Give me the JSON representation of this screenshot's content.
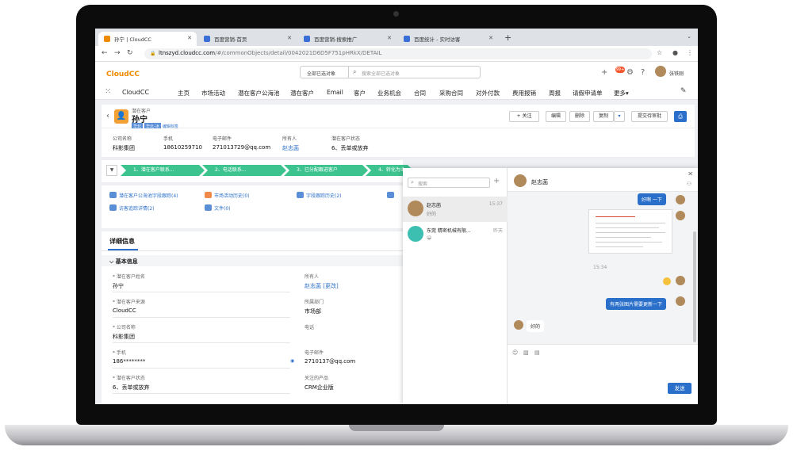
{
  "browser": {
    "tabs": [
      {
        "label": "孙宁 | CloudCC",
        "icon": "cloudcc-icon",
        "color": "#f08a00"
      },
      {
        "label": "百度营销-首页",
        "icon": "baidu-paw-icon",
        "color": "#3a6fd8"
      },
      {
        "label": "百度营销-搜索推广",
        "icon": "baidu-paw-icon",
        "color": "#3a6fd8"
      },
      {
        "label": "百度统计 - 实时访客",
        "icon": "baidu-stats-icon",
        "color": "#3a6fd8"
      }
    ],
    "url_host": "ltnszyd.cloudcc.com",
    "url_path": "/#/commonObjects/detail/0042021D6D5F751pHRkX/DETAIL"
  },
  "topbar": {
    "logo": "CloudCC",
    "search_scope": "全部已选对象",
    "search_placeholder": "搜索全部已选对象",
    "notification_count": "99+",
    "username": "张铁刚"
  },
  "nav": {
    "app_name": "CloudCC",
    "items": [
      "主页",
      "市场活动",
      "潜在客户公海池",
      "潜在客户",
      "Email",
      "客户",
      "业务机会",
      "合同",
      "采购合同",
      "对外付款",
      "费用报销",
      "周报",
      "请假申请单",
      "更多▾"
    ]
  },
  "record": {
    "type": "潜在客户",
    "name": "孙宁",
    "tags": [
      "华北",
      "华北-冰"
    ],
    "tag_edit": "编辑标签",
    "buttons": {
      "follow": "+ 关注",
      "edit": "编辑",
      "delete": "删除",
      "copy": "复制",
      "submit": "提交待审批"
    }
  },
  "summary_fields": [
    {
      "label": "公司名称",
      "value": "科影集团"
    },
    {
      "label": "手机",
      "value": "18610259710"
    },
    {
      "label": "电子邮件",
      "value": "271013729@qq.com"
    },
    {
      "label": "所有人",
      "value": "赵志菡"
    },
    {
      "label": "潜在客户状态",
      "value": "6、丢单或放弃"
    }
  ],
  "path_steps": [
    "1、潜在客户联系...",
    "2、电话联系...",
    "3、已分配跟进客户",
    "4、转化为业务..."
  ],
  "related": [
    {
      "label": "潜在客户公海池字段跟踪(4)",
      "color": "#5a8fd8"
    },
    {
      "label": "市场活动历史(0)",
      "color": "#f08a4b"
    },
    {
      "label": "字段跟踪历史(2)",
      "color": "#5a8fd8"
    },
    {
      "label": "访客追踪详情(2)",
      "color": "#5a8fd8"
    },
    {
      "label": "文件(0)",
      "color": "#5a8fd8"
    }
  ],
  "detail": {
    "tab": "详细信息",
    "section": "基本信息",
    "fields": [
      {
        "label": "* 潜在客户姓名",
        "value": "孙宁"
      },
      {
        "label": "所有人",
        "value": "赵志菡 [更改]"
      },
      {
        "label": "* 潜在客户来源",
        "value": "CloudCC"
      },
      {
        "label": "所属部门",
        "value": "市场部"
      },
      {
        "label": "* 公司名称",
        "value": "科影集团"
      },
      {
        "label": "电话",
        "value": ""
      },
      {
        "label": "* 手机",
        "value": "186********"
      },
      {
        "label": "电子邮件",
        "value": "2710137@qq.com"
      },
      {
        "label": "* 潜在客户状态",
        "value": "6、丢单或放弃"
      },
      {
        "label": "关注的产品",
        "value": "CRM企业版"
      }
    ]
  },
  "chat": {
    "search_placeholder": "搜索",
    "conversations": [
      {
        "name": "赵志菡",
        "preview": "好的",
        "time": "15:37"
      },
      {
        "name": "东莞 精密机械有限...",
        "preview": "😀",
        "time": "昨天"
      }
    ],
    "header_name": "赵志菡",
    "messages": {
      "top_bubble": "好啊 一下",
      "time": "15:34",
      "outgoing": "有两张图片需要更新一下",
      "incoming": "好的"
    },
    "send_label": "发送"
  }
}
